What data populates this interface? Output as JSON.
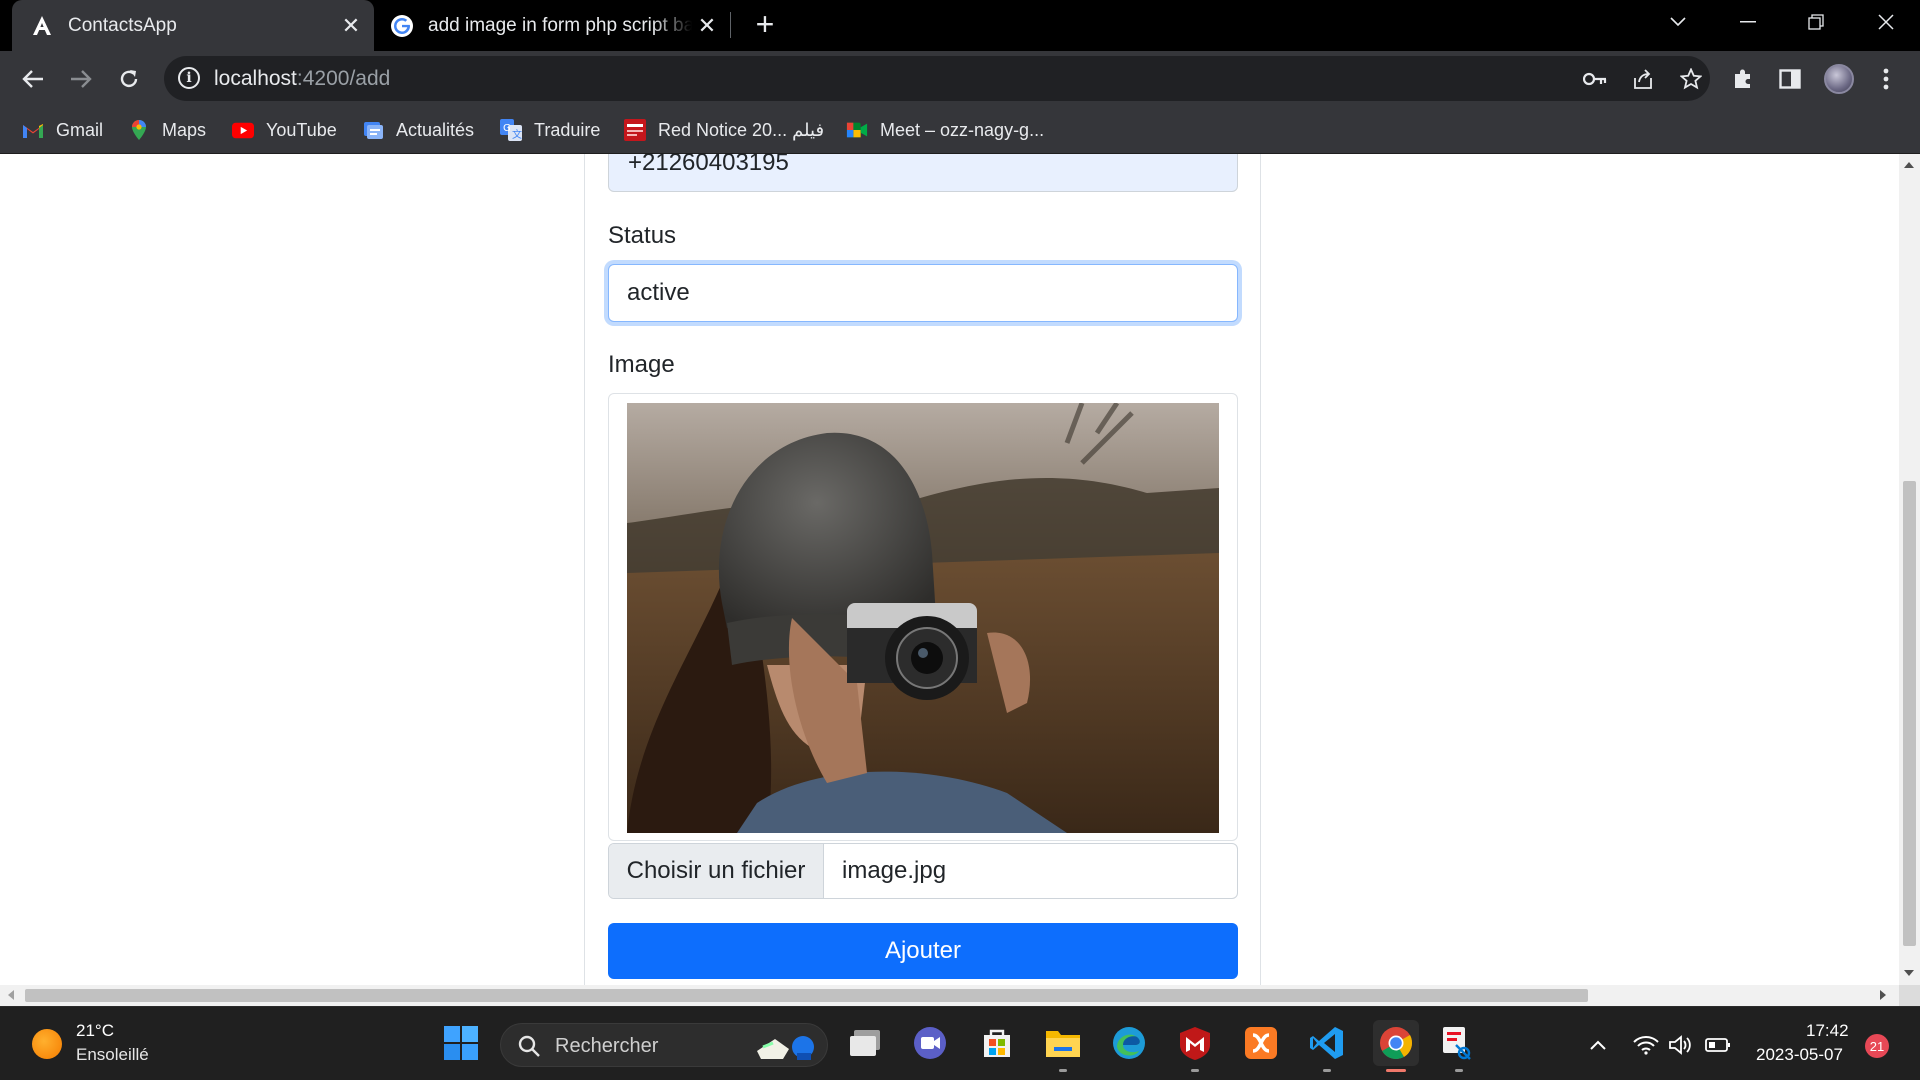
{
  "browser": {
    "tabs": [
      {
        "title": "ContactsApp",
        "favicon": "angular-icon",
        "active": true
      },
      {
        "title": "add image in form php script back",
        "favicon": "google-icon",
        "active": false
      }
    ],
    "address": {
      "host": "localhost",
      "path": ":4200/add"
    },
    "bookmarks": [
      {
        "label": "Gmail",
        "icon": "gmail-icon"
      },
      {
        "label": "Maps",
        "icon": "maps-icon"
      },
      {
        "label": "YouTube",
        "icon": "youtube-icon"
      },
      {
        "label": "Actualités",
        "icon": "news-icon"
      },
      {
        "label": "Traduire",
        "icon": "translate-icon"
      },
      {
        "label": "Red Notice 20... فيلم",
        "icon": "red-notice-icon"
      },
      {
        "label": "Meet – ozz-nagy-g...",
        "icon": "meet-icon"
      }
    ]
  },
  "form": {
    "phone_value": "+21260403195",
    "status_label": "Status",
    "status_value": "active",
    "image_label": "Image",
    "file_button_label": "Choisir un fichier",
    "file_name": "image.jpg",
    "submit_label": "Ajouter"
  },
  "taskbar": {
    "weather_temp": "21°C",
    "weather_desc": "Ensoleillé",
    "search_placeholder": "Rechercher",
    "time": "17:42",
    "date": "2023-05-07",
    "notification_count": "21"
  },
  "colors": {
    "primary": "#0d6efd",
    "autofill": "#e8f0fe",
    "chrome_dark": "#35363a",
    "taskbar": "#202020"
  }
}
